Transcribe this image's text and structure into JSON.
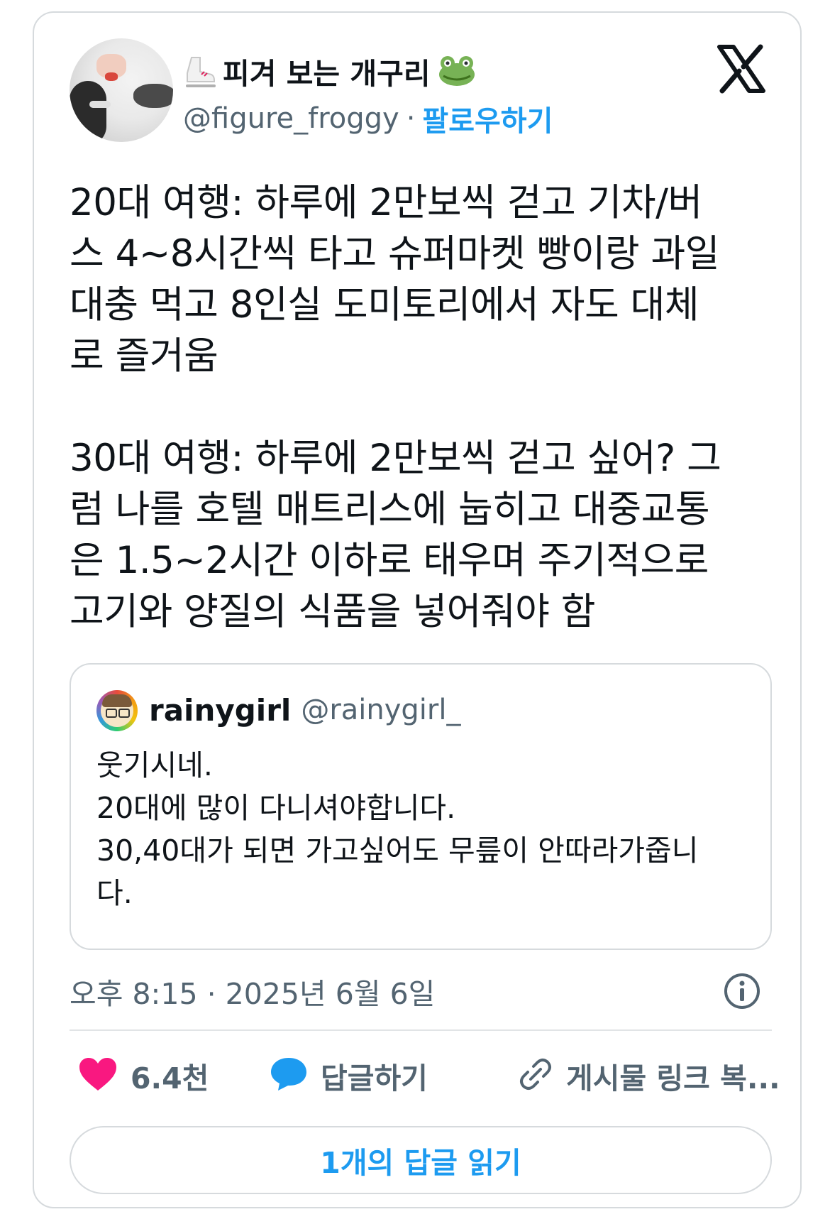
{
  "author": {
    "display_name": "피겨 보는 개구리",
    "handle": "@figure_froggy",
    "separator": "·",
    "follow_label": "팔로우하기",
    "name_prefix_icon": "ice-skate-icon",
    "name_suffix_icon": "frog-face-icon"
  },
  "platform_icon": "x-logo-icon",
  "tweet": {
    "text": "20대 여행: 하루에 2만보씩 걷고 기차/버\n스 4~8시간씩 타고 슈퍼마켓 빵이랑 과일\n대충 먹고 8인실 도미토리에서 자도 대체\n로 즐거움\n\n30대 여행: 하루에 2만보씩 걷고 싶어? 그\n럼 나를 호텔 매트리스에 눕히고 대중교통\n은 1.5~2시간 이하로 태우며 주기적으로\n고기와 양질의 식품을 넣어줘야 함"
  },
  "quoted_tweet": {
    "display_name": "rainygirl",
    "handle": "@rainygirl_",
    "text": "웃기시네.\n20대에 많이 다니셔야합니다.\n30,40대가 되면 가고싶어도 무릎이 안따라가줍니\n다."
  },
  "meta": {
    "timestamp": "오후 8:15 · 2025년 6월 6일",
    "info_icon": "info-icon"
  },
  "actions": {
    "like_count": "6.4천",
    "reply_label": "답글하기",
    "copy_link_label": "게시물 링크 복..."
  },
  "read_replies_label": "1개의 답글 읽기",
  "colors": {
    "accent": "#1d9bf0",
    "like": "#f91880",
    "text": "#0f1419",
    "muted": "#536471",
    "border": "#d6dadd"
  }
}
